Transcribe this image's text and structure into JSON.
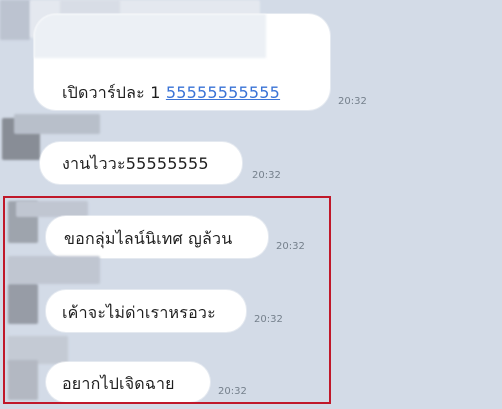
{
  "chat": {
    "messages": [
      {
        "text": "เปิดวาร์ปละ 1 ",
        "link": "55555555555",
        "time": "20:32"
      },
      {
        "text": "งานไววะ55555555",
        "time": "20:32"
      },
      {
        "text": "ขอกลุ่มไลน์นิเทศ ญล้วน",
        "time": "20:32"
      },
      {
        "text": "เค้าจะไม่ด่าเราหรอวะ",
        "time": "20:32"
      },
      {
        "text": "อยากไปเจิดฉาย",
        "time": "20:32"
      }
    ]
  },
  "colors": {
    "background": "#d3dbe7",
    "bubble": "#ffffff",
    "link": "#3a73d6",
    "highlight": "#c0182a",
    "timestamp": "#75808c"
  }
}
